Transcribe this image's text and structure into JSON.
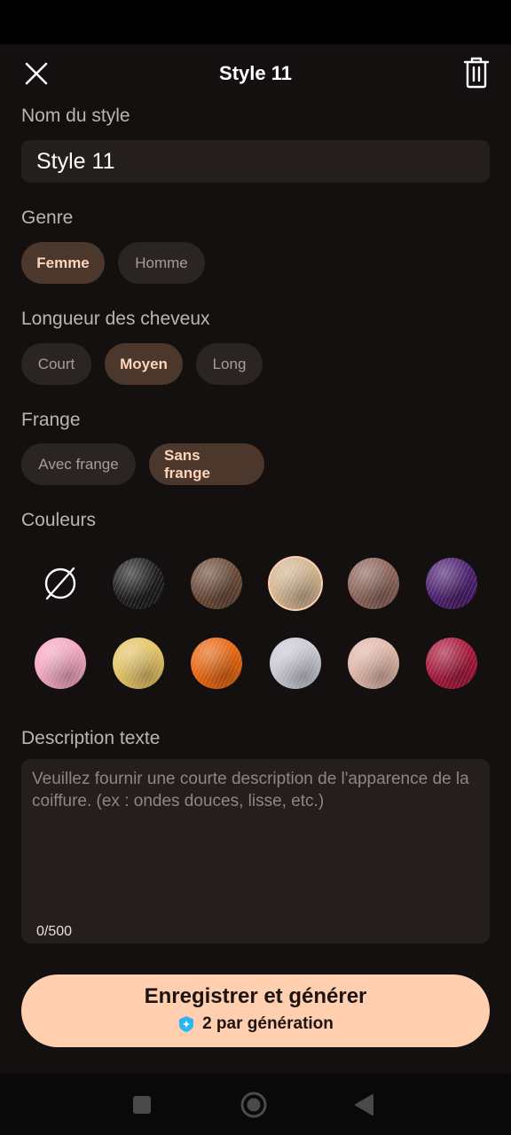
{
  "header": {
    "title": "Style 11"
  },
  "name_section": {
    "label": "Nom du style",
    "value": "Style 11"
  },
  "genre": {
    "label": "Genre",
    "options": [
      {
        "label": "Femme",
        "selected": true
      },
      {
        "label": "Homme",
        "selected": false
      }
    ]
  },
  "longueur": {
    "label": "Longueur des cheveux",
    "options": [
      {
        "label": "Court",
        "selected": false
      },
      {
        "label": "Moyen",
        "selected": true
      },
      {
        "label": "Long",
        "selected": false
      }
    ]
  },
  "frange": {
    "label": "Frange",
    "options": [
      {
        "label": "Avec frange",
        "selected": false
      },
      {
        "label": "Sans frange",
        "selected": true
      }
    ]
  },
  "couleurs": {
    "label": "Couleurs",
    "swatches": [
      {
        "icon": "no-color-icon",
        "color": "none"
      },
      {
        "icon": "hair-swatch",
        "color": "#1e1e1e"
      },
      {
        "icon": "hair-swatch",
        "color": "#6b4a38"
      },
      {
        "icon": "hair-swatch",
        "color": "#d2b48f",
        "selected": true
      },
      {
        "icon": "hair-swatch",
        "color": "#8c6459"
      },
      {
        "icon": "hair-swatch",
        "color": "#4d1f70"
      },
      {
        "icon": "hair-swatch",
        "color": "#f4a6c2"
      },
      {
        "icon": "hair-swatch",
        "color": "#e5c364"
      },
      {
        "icon": "hair-swatch",
        "color": "#e9650f"
      },
      {
        "icon": "hair-swatch",
        "color": "#c8c8d2"
      },
      {
        "icon": "hair-swatch",
        "color": "#e0b6a8"
      },
      {
        "icon": "hair-swatch",
        "color": "#a8163a"
      }
    ]
  },
  "description": {
    "label": "Description texte",
    "placeholder": "Veuillez fournir une courte description de l'apparence de la coiffure. (ex : ondes douces, lisse, etc.)",
    "counter": "0/500"
  },
  "primary_button": {
    "label": "Enregistrer et générer",
    "cost": "2 par génération",
    "cost_icon": "gem-icon"
  },
  "colors": {
    "accent": "#ffcfb0",
    "background": "#141010",
    "chip_selected": "#4b372b"
  }
}
